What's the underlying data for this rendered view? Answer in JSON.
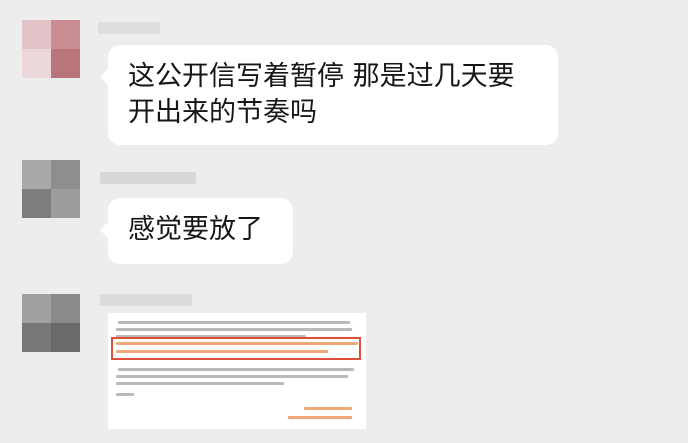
{
  "messages": [
    {
      "type": "text",
      "text": "这公开信写着暂停 那是过几天要开出来的节奏吗"
    },
    {
      "type": "text",
      "text": "感觉要放了"
    },
    {
      "type": "image",
      "image_desc": "blurred-screenshot-of-letter"
    }
  ],
  "colors": {
    "background": "#ededed",
    "bubble": "#ffffff",
    "text": "#161616",
    "highlight_box": "#e14d3b",
    "highlight_text": "#f0a77a"
  }
}
